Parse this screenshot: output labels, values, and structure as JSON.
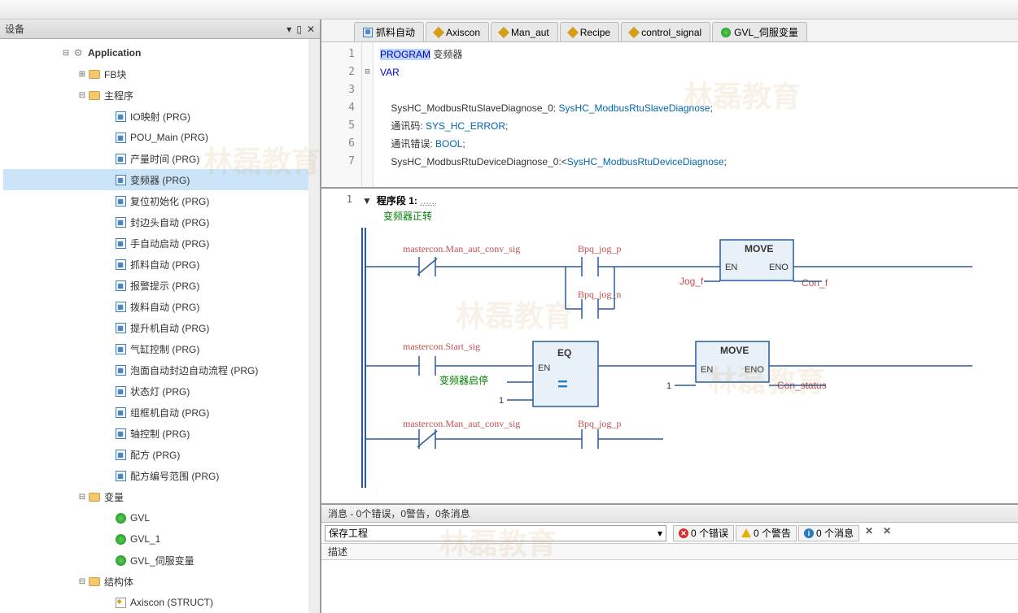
{
  "sidebar": {
    "title": "设备",
    "app": "Application",
    "folders": {
      "fb": "FB块",
      "main_prog": "主程序",
      "vars": "变量",
      "structs": "结构体"
    },
    "prgs": [
      "IO映射 (PRG)",
      "POU_Main (PRG)",
      "产量时间 (PRG)",
      "变频器 (PRG)",
      "复位初始化 (PRG)",
      "封边头自动 (PRG)",
      "手自动启动 (PRG)",
      "抓料自动 (PRG)",
      "报警提示 (PRG)",
      "拨料自动 (PRG)",
      "提升机自动 (PRG)",
      "气缸控制 (PRG)",
      "泡面自动封边自动流程 (PRG)",
      "状态灯 (PRG)",
      "组框机自动 (PRG)",
      "轴控制 (PRG)",
      "配方 (PRG)",
      "配方编号范围 (PRG)"
    ],
    "gvls": [
      "GVL",
      "GVL_1",
      "GVL_伺服变量"
    ],
    "struct_item": "Axiscon (STRUCT)"
  },
  "tabs": [
    {
      "label": "抓料自动",
      "type": "prg"
    },
    {
      "label": "Axiscon",
      "type": "struct"
    },
    {
      "label": "Man_aut",
      "type": "struct"
    },
    {
      "label": "Recipe",
      "type": "struct"
    },
    {
      "label": "control_signal",
      "type": "struct"
    },
    {
      "label": "GVL_伺服变量",
      "type": "gvl"
    }
  ],
  "code": {
    "l1a": "PROGRAM",
    "l1b": " 变频器",
    "l2": "VAR",
    "l4": "    SysHC_ModbusRtuSlaveDiagnose_0: ",
    "l4t": "SysHC_ModbusRtuSlaveDiagnose",
    "l5": "    通讯码: ",
    "l5t": "SYS_HC_ERROR",
    "l6": "    通讯错误: ",
    "l6t": "BOOL",
    "l7": "    SysHC_ModbusRtuDeviceDiagnose_0:<",
    "l7t": "SysHC_ModbusRtuDeviceDiagnose"
  },
  "rung": {
    "title": "程序段  1:",
    "dots": "......",
    "comment": "变频器正转",
    "sig1": "mastercon.Man_aut_conv_sig",
    "sig2": "Bpq_jog_p",
    "sig3": "Bpq_jog_n",
    "sig4": "mastercon.Start_sig",
    "sig5": "变频器启停",
    "sig6": "mastercon.Man_aut_conv_sig",
    "sig7": "Bpq_jog_p",
    "move": "MOVE",
    "eq": "EQ",
    "en": "EN",
    "eno": "ENO",
    "jog_f": "Jog_f",
    "con_f": "Con_f",
    "con_status": "Con_status",
    "one": "1"
  },
  "messages": {
    "header": "消息 - 0个错误，0警告，0条消息",
    "combo": "保存工程",
    "errors": "0 个错误",
    "warnings": "0 个警告",
    "infos": "0 个消息",
    "desc": "描述"
  },
  "watermark": "林磊教育"
}
